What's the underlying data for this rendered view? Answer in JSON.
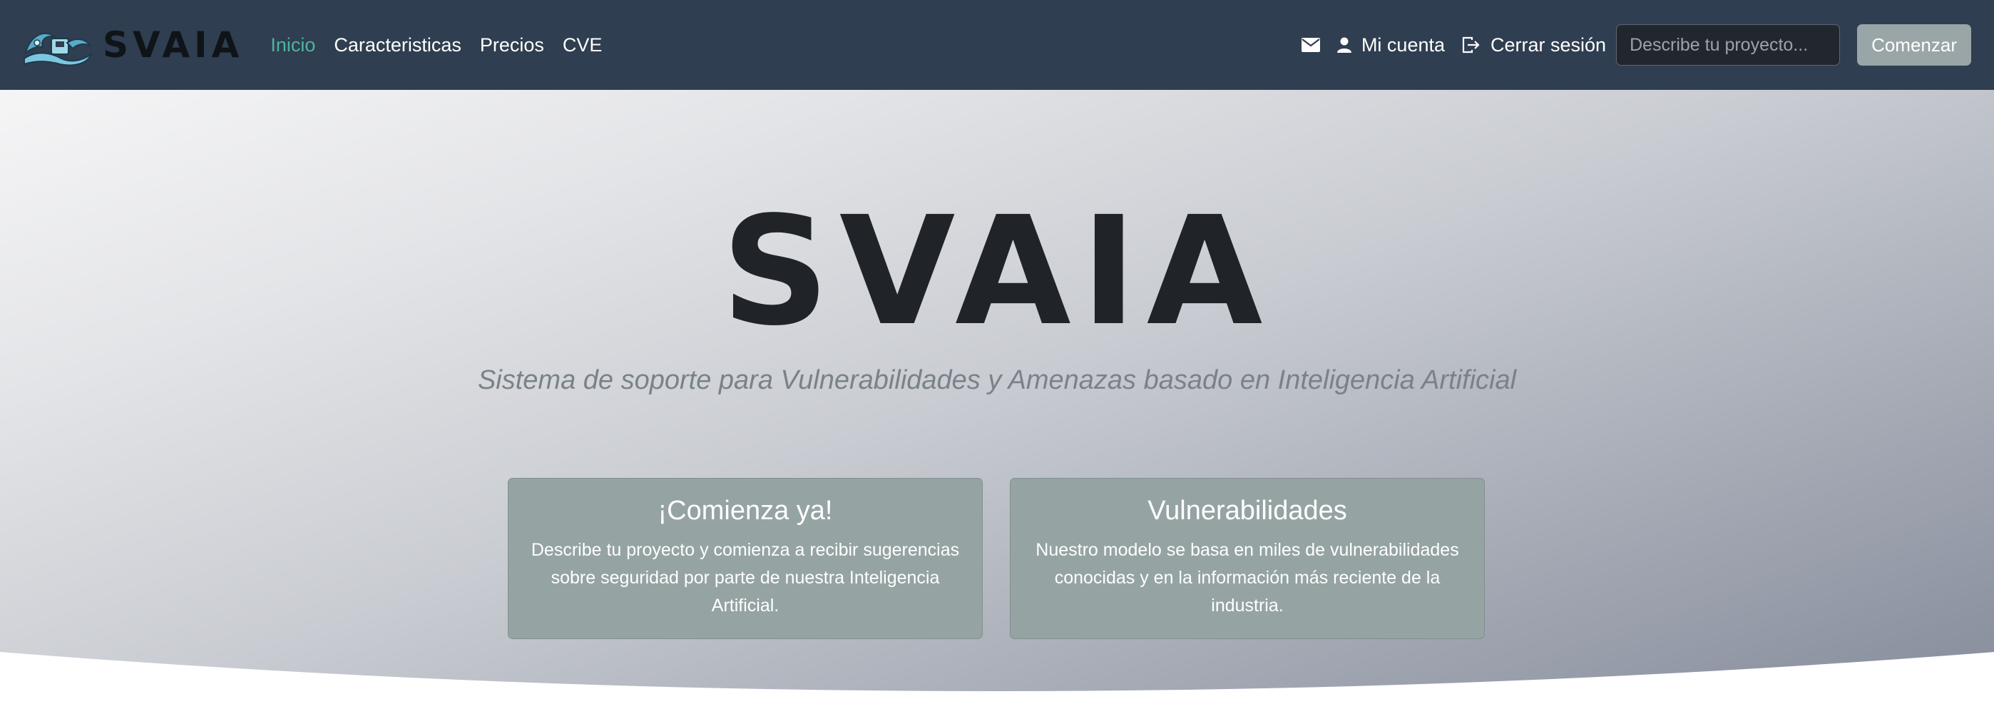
{
  "brand": {
    "name": "SVAIA",
    "logo_icon": "wave-logo-icon"
  },
  "nav": {
    "links": [
      "Inicio",
      "Caracteristicas",
      "Precios",
      "CVE"
    ],
    "active": "Inicio",
    "mail_icon": "envelope-icon",
    "account_label": "Mi cuenta",
    "account_icon": "user-icon",
    "logout_label": "Cerrar sesión",
    "logout_icon": "logout-icon",
    "search_placeholder": "Describe tu proyecto...",
    "start_button": "Comenzar"
  },
  "hero": {
    "title": "SVAIA",
    "subtitle": "Sistema de soporte para Vulnerabilidades y Amenazas basado en Inteligencia Artificial"
  },
  "cards": [
    {
      "title": "¡Comienza ya!",
      "text": "Describe tu proyecto y comienza a recibir sugerencias sobre seguridad por parte de nuestra Inteligencia Artificial."
    },
    {
      "title": "Vulnerabilidades",
      "text": "Nuestro modelo se basa en miles de vulnerabilidades conocidas y en la información más reciente de la industria."
    }
  ],
  "colors": {
    "navbar": "#2f3e50",
    "active_link": "#4fb3a0",
    "card_bg": "#95a3a3",
    "button_bg": "#9aa5a7"
  }
}
